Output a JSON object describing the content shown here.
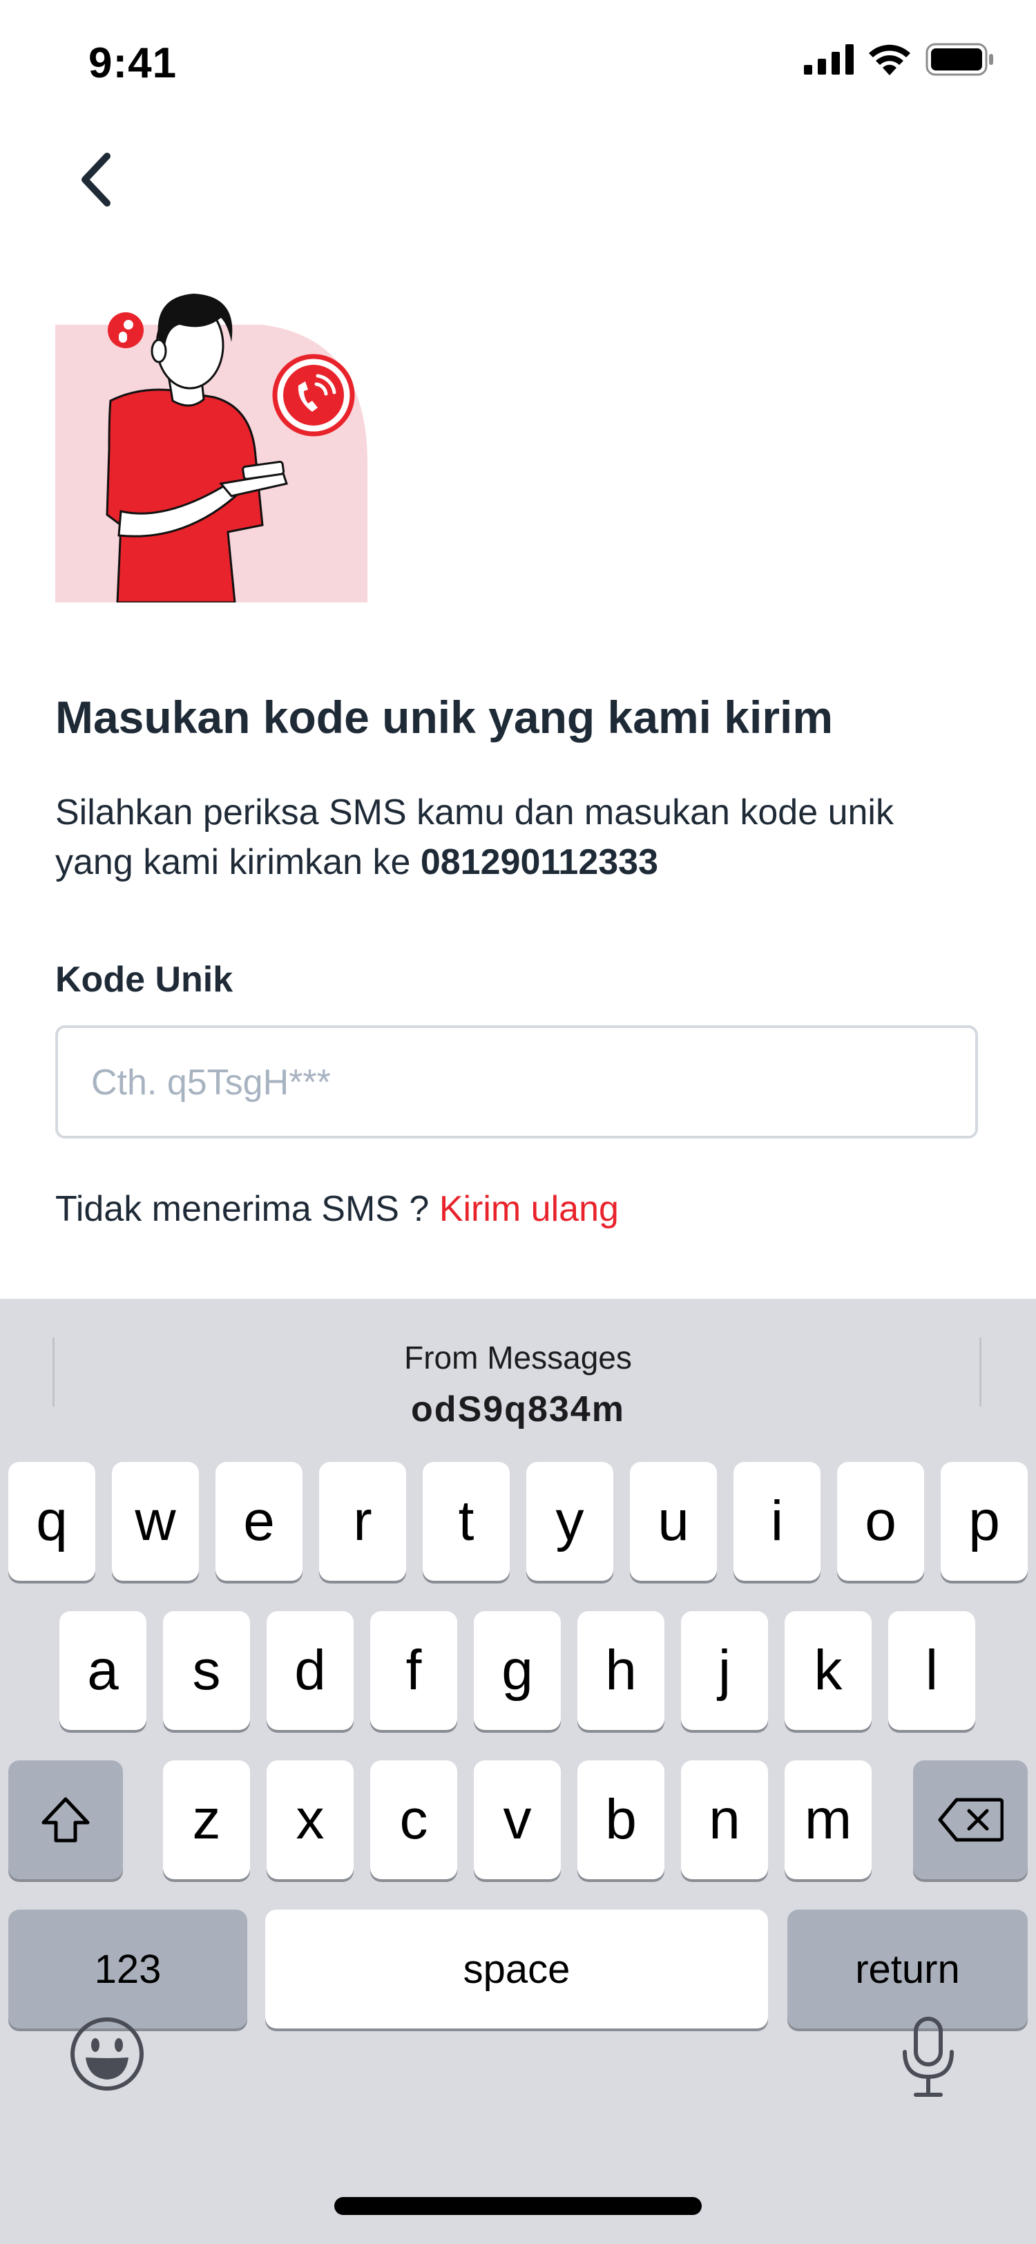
{
  "status_bar": {
    "time": "9:41"
  },
  "screen": {
    "title": "Masukan kode unik yang kami kirim",
    "description_prefix": "Silahkan periksa SMS kamu dan masukan kode unik yang kami kirimkan ke ",
    "phone_number": "081290112333",
    "field_label": "Kode Unik",
    "field_placeholder": "Cth. q5TsgH***",
    "resend_prefix": "Tidak menerima SMS ? ",
    "resend_link": "Kirim ulang"
  },
  "keyboard": {
    "suggestion_source": "From Messages",
    "suggestion_code": "odS9q834m",
    "row1": [
      "q",
      "w",
      "e",
      "r",
      "t",
      "y",
      "u",
      "i",
      "o",
      "p"
    ],
    "row2": [
      "a",
      "s",
      "d",
      "f",
      "g",
      "h",
      "j",
      "k",
      "l"
    ],
    "row3": [
      "z",
      "x",
      "c",
      "v",
      "b",
      "n",
      "m"
    ],
    "numbers_label": "123",
    "space_label": "space",
    "return_label": "return"
  },
  "colors": {
    "accent": "#e8232b",
    "text": "#1f2a37",
    "placeholder": "#a8b3c1",
    "keyboard_bg": "#d9dbe1",
    "illustration_bg": "#f8d7dc"
  },
  "icons": [
    "back-chevron-icon",
    "signal-icon",
    "wifi-icon",
    "battery-icon",
    "shift-icon",
    "delete-icon",
    "emoji-icon",
    "microphone-icon"
  ]
}
